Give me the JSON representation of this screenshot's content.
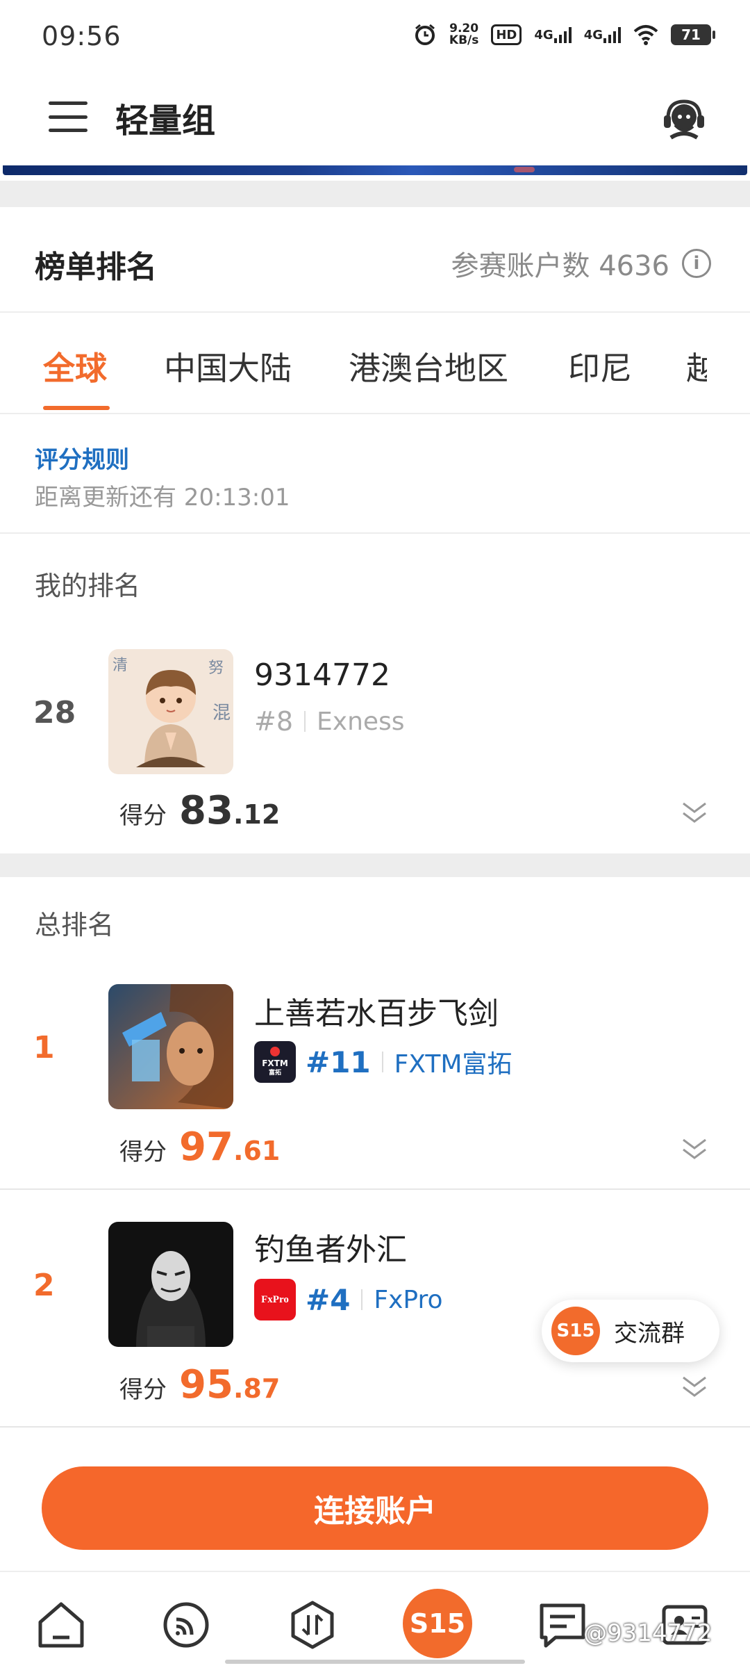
{
  "status_bar": {
    "time": "09:56",
    "net_speed_value": "9.20",
    "net_speed_unit": "KB/s",
    "hd_label": "HD",
    "signal1": "4G",
    "signal2": "4G",
    "battery": "71"
  },
  "app_bar": {
    "title": "轻量组"
  },
  "ranking": {
    "title": "榜单排名",
    "participants_label": "参赛账户数 4636",
    "info_icon": "i"
  },
  "tabs": [
    {
      "label": "全球",
      "active": true
    },
    {
      "label": "中国大陆"
    },
    {
      "label": "港澳台地区"
    },
    {
      "label": "印尼"
    },
    {
      "label": "越"
    }
  ],
  "rules": {
    "link": "评分规则",
    "countdown": "距离更新还有 20:13:01"
  },
  "my_ranking": {
    "section_title": "我的排名",
    "rank": "28",
    "name": "9314772",
    "broker_rank": "#8",
    "broker": "Exness",
    "score_label": "得分",
    "score_int": "83",
    "score_dec": ".12"
  },
  "total_ranking": {
    "section_title": "总排名",
    "rows": [
      {
        "rank": "1",
        "name": "上善若水百步飞剑",
        "broker_logo": "FXTM",
        "broker_logo_sub": "富拓",
        "broker_rank": "#11",
        "broker": "FXTM富拓",
        "score_label": "得分",
        "score_int": "97",
        "score_dec": ".61"
      },
      {
        "rank": "2",
        "name": "钓鱼者外汇",
        "broker_logo": "FxPro",
        "broker_rank": "#4",
        "broker": "FxPro",
        "score_label": "得分",
        "score_int": "95",
        "score_dec": ".87"
      }
    ]
  },
  "float_button": {
    "badge": "S15",
    "label": "交流群"
  },
  "connect_button": "连接账户",
  "bottom_nav": {
    "center_badge": "S15",
    "watermark": "@9314772"
  },
  "colors": {
    "accent": "#f26b2c",
    "link": "#1f6fc1",
    "gray": "#8a8a8a"
  }
}
